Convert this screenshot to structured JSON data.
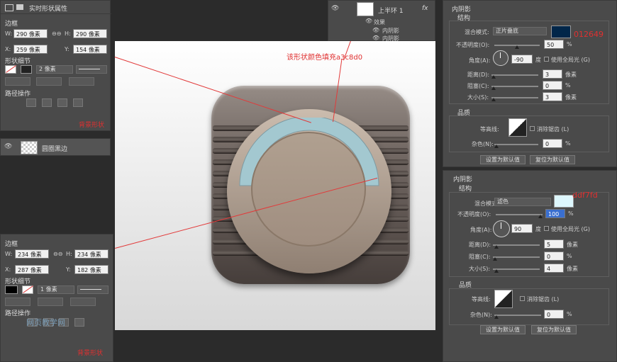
{
  "left_panel_top": {
    "title": "实时形状属性",
    "section_border": "边框",
    "w_label": "W:",
    "w_value": "290 像素",
    "h_label": "H:",
    "h_value": "290 像素",
    "x_label": "X:",
    "x_value": "259 像素",
    "y_label": "Y:",
    "y_value": "154 像素",
    "section_stroke": "形状细节",
    "stroke_size": "2 像素",
    "section_path": "路径操作",
    "note": "背景形状"
  },
  "layer_item": {
    "name": "圆圈黑边"
  },
  "left_panel_bottom": {
    "section_border": "边框",
    "w_label": "W:",
    "w_value": "234 像素",
    "h_label": "H:",
    "h_value": "234 像素",
    "x_label": "X:",
    "x_value": "287 像素",
    "y_label": "Y:",
    "y_value": "182 像素",
    "section_stroke": "形状细节",
    "stroke_size": "1 像素",
    "section_path": "路径操作",
    "note": "背景形状"
  },
  "layers_panel": {
    "layer_name": "上半环 1",
    "fx_label": "fx",
    "effects_label": "效果",
    "effect_1": "内阴影",
    "effect_2": "内阴影"
  },
  "annotation": {
    "text": "该形状颜色填充a3c8d0"
  },
  "inner_shadow_1": {
    "section": "内阴影",
    "structure": "结构",
    "blend_label": "混合模式:",
    "blend_value": "正片叠底",
    "color_hex": "012649",
    "swatch_color": "#012649",
    "opacity_label": "不透明度(O):",
    "opacity_value": "50",
    "percent": "%",
    "angle_label": "角度(A):",
    "angle_value": "-90",
    "degree": "度",
    "global_light": "使用全局光 (G)",
    "distance_label": "距离(D):",
    "distance_value": "3",
    "px": "像素",
    "choke_label": "阻塞(C):",
    "choke_value": "0",
    "size_label": "大小(S):",
    "size_value": "3",
    "quality": "品质",
    "contour_label": "等高线:",
    "antialias": "消除锯齿 (L)",
    "noise_label": "杂色(N):",
    "noise_value": "0",
    "btn_default": "设置为默认值",
    "btn_reset": "复位为默认值"
  },
  "inner_shadow_2": {
    "section": "内阴影",
    "structure": "结构",
    "blend_label": "混合模式:",
    "blend_value": "滤色",
    "color_hex": "ddf7fd",
    "swatch_color": "#ddf7fd",
    "opacity_label": "不透明度(O):",
    "opacity_value": "100",
    "percent": "%",
    "angle_label": "角度(A):",
    "angle_value": "90",
    "degree": "度",
    "global_light": "使用全局光 (G)",
    "distance_label": "距离(D):",
    "distance_value": "5",
    "px": "像素",
    "choke_label": "阻塞(C):",
    "choke_value": "0",
    "size_label": "大小(S):",
    "size_value": "4",
    "quality": "品质",
    "contour_label": "等高线:",
    "antialias": "消除锯齿 (L)",
    "noise_label": "杂色(N):",
    "noise_value": "0",
    "btn_default": "设置为默认值",
    "btn_reset": "复位为默认值"
  },
  "watermark": {
    "text": "网页教学网"
  }
}
